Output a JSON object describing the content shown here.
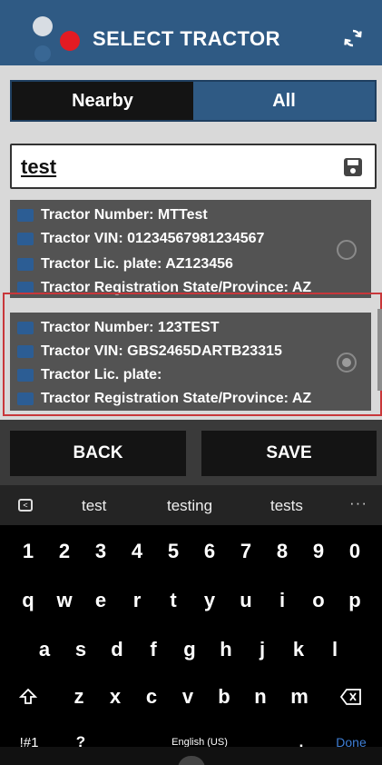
{
  "header": {
    "title": "SELECT TRACTOR",
    "refresh_icon": "refresh-icon",
    "colors": {
      "header": "#2f5a84",
      "logo_red": "#e31b23"
    }
  },
  "tabs": [
    {
      "label": "Nearby",
      "active": false
    },
    {
      "label": "All",
      "active": true
    }
  ],
  "search": {
    "value": "test",
    "placeholder": "",
    "icon": "save-icon"
  },
  "tractors": [
    {
      "number_line": "Tractor Number: MTTest",
      "vin_line": "Tractor VIN: 01234567981234567",
      "plate_line": "Tractor Lic. plate: AZ123456",
      "state_line": "Tractor Registration State/Province: AZ",
      "selected": false
    },
    {
      "number_line": "Tractor Number: 123TEST",
      "vin_line": "Tractor VIN: GBS2465DARTB23315",
      "plate_line": "Tractor Lic. plate:",
      "state_line": "Tractor Registration State/Province: AZ",
      "selected": true
    }
  ],
  "actions": {
    "back_label": "BACK",
    "save_label": "SAVE"
  },
  "keyboard": {
    "suggestions": [
      "test",
      "testing",
      "tests"
    ],
    "more_label": "···",
    "row_numbers": [
      "1",
      "2",
      "3",
      "4",
      "5",
      "6",
      "7",
      "8",
      "9",
      "0"
    ],
    "row_1": [
      "q",
      "w",
      "e",
      "r",
      "t",
      "y",
      "u",
      "i",
      "o",
      "p"
    ],
    "row_2": [
      "a",
      "s",
      "d",
      "f",
      "g",
      "h",
      "j",
      "k",
      "l"
    ],
    "row_3": [
      "z",
      "x",
      "c",
      "v",
      "b",
      "n",
      "m"
    ],
    "symbols_label": "!#1",
    "question_label": "?",
    "space_label": "English (US)",
    "period_label": ".",
    "done_label": "Done"
  }
}
